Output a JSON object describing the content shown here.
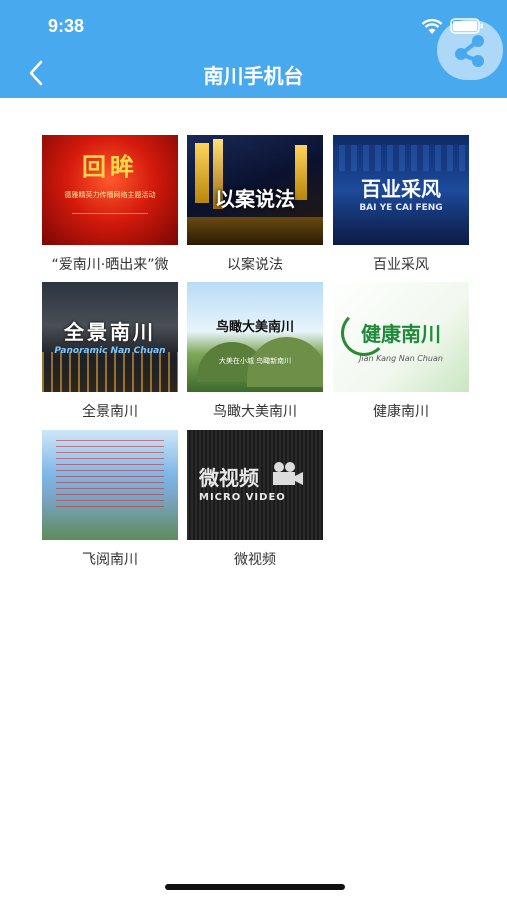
{
  "status_bar": {
    "time": "9:38"
  },
  "header": {
    "title": "南川手机台",
    "accent": "#49a9ee"
  },
  "tiles": [
    {
      "caption": "“爱南川·晒出来”微",
      "thumb_title": "回眸",
      "thumb_sub": "德雅精英力传播网络主题活动"
    },
    {
      "caption": "以案说法",
      "thumb_title": "以案说法"
    },
    {
      "caption": "百业采风",
      "thumb_title": "百业采风",
      "thumb_sub": "BAI YE CAI FENG"
    },
    {
      "caption": "全景南川",
      "thumb_title": "全景南川",
      "thumb_sub": "Panoramic Nan Chuan"
    },
    {
      "caption": "鸟瞰大美南川",
      "thumb_title": "鸟瞰大美南川",
      "thumb_sub": "大美在小城  鸟瞰新南川"
    },
    {
      "caption": "健康南川",
      "thumb_title": "健康南川",
      "thumb_sub": "Jian Kang Nan Chuan"
    },
    {
      "caption": "飞阅南川"
    },
    {
      "caption": "微视频",
      "thumb_title": "微视频",
      "thumb_sub": "MICRO VIDEO"
    }
  ]
}
